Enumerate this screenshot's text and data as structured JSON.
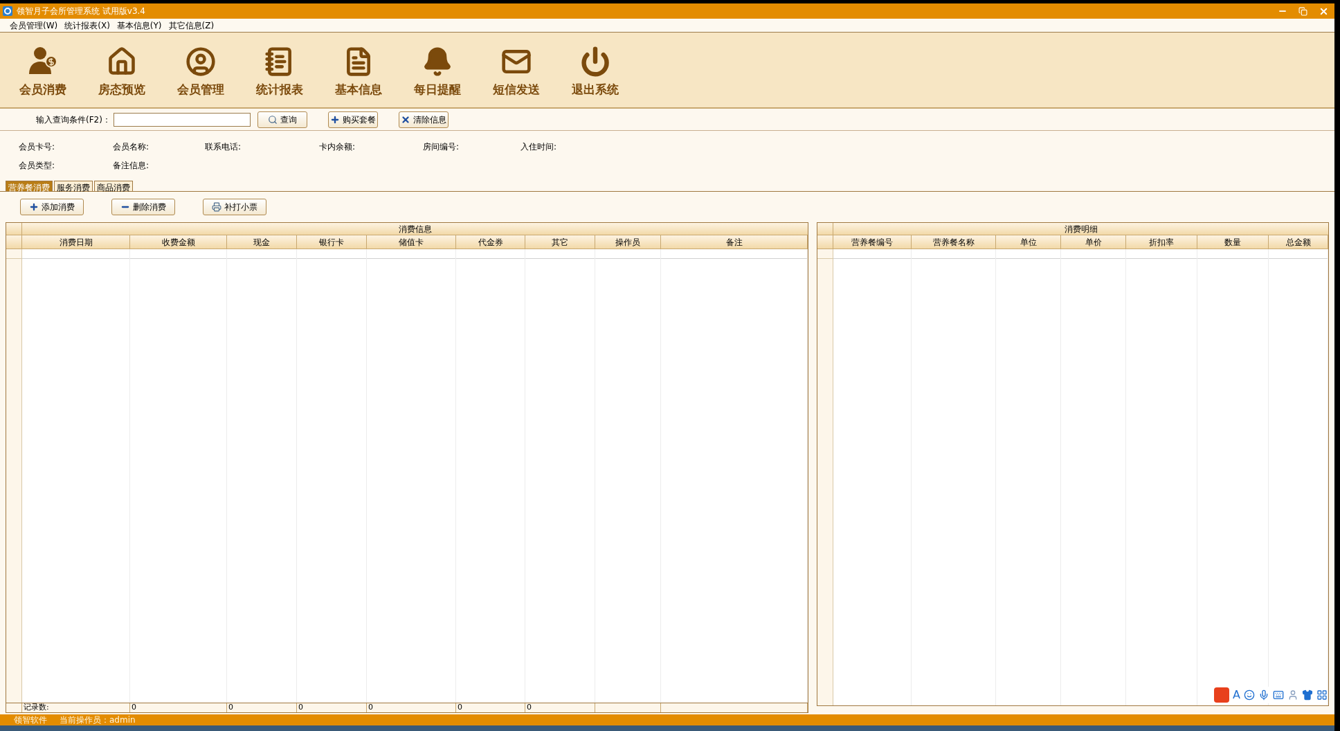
{
  "window": {
    "title": "领智月子会所管理系统 试用版v3.4"
  },
  "menu": [
    "会员管理(W)",
    "统计报表(X)",
    "基本信息(Y)",
    "其它信息(Z)"
  ],
  "toolbar": [
    {
      "kind": "consume",
      "label": "会员消费"
    },
    {
      "kind": "house",
      "label": "房态预览"
    },
    {
      "kind": "member",
      "label": "会员管理"
    },
    {
      "kind": "report",
      "label": "统计报表"
    },
    {
      "kind": "info",
      "label": "基本信息"
    },
    {
      "kind": "bell",
      "label": "每日提醒"
    },
    {
      "kind": "mail",
      "label": "短信发送"
    },
    {
      "kind": "power",
      "label": "退出系统"
    }
  ],
  "search": {
    "label": "输入查询条件(F2)：",
    "buttons": [
      {
        "kind": "search",
        "label": "查询"
      },
      {
        "kind": "plus",
        "label": "购买套餐"
      },
      {
        "kind": "clear",
        "label": "清除信息"
      }
    ]
  },
  "member_info": [
    [
      "会员卡号:",
      "会员名称:",
      "联系电话:",
      "卡内余额:",
      "房间编号:",
      "入住时间:"
    ],
    [
      "会员类型:",
      "备注信息:"
    ]
  ],
  "tabs": [
    {
      "label": "营养餐消费",
      "selected": true
    },
    {
      "label": "服务消费",
      "selected": false
    },
    {
      "label": "商品消费",
      "selected": false
    }
  ],
  "actions": [
    {
      "kind": "plus",
      "label": "添加消费"
    },
    {
      "kind": "minus",
      "label": "删除消费"
    },
    {
      "kind": "print",
      "label": "补打小票"
    }
  ],
  "consumption_table": {
    "title": "消费信息",
    "columns": [
      "消费日期",
      "收费金额",
      "现金",
      "银行卡",
      "储值卡",
      "代金券",
      "其它",
      "操作员",
      "备注"
    ],
    "footer": [
      "记录数:",
      "0",
      "0",
      "0",
      "0",
      "0",
      "0"
    ]
  },
  "detail_table": {
    "title": "消费明细",
    "columns": [
      "营养餐编号",
      "营养餐名称",
      "单位",
      "单价",
      "折扣率",
      "数量",
      "总金额"
    ]
  },
  "ime_toolbar": {
    "label": "A"
  },
  "status_bar": {
    "company": "领智软件",
    "operator": "当前操作员：admin"
  }
}
